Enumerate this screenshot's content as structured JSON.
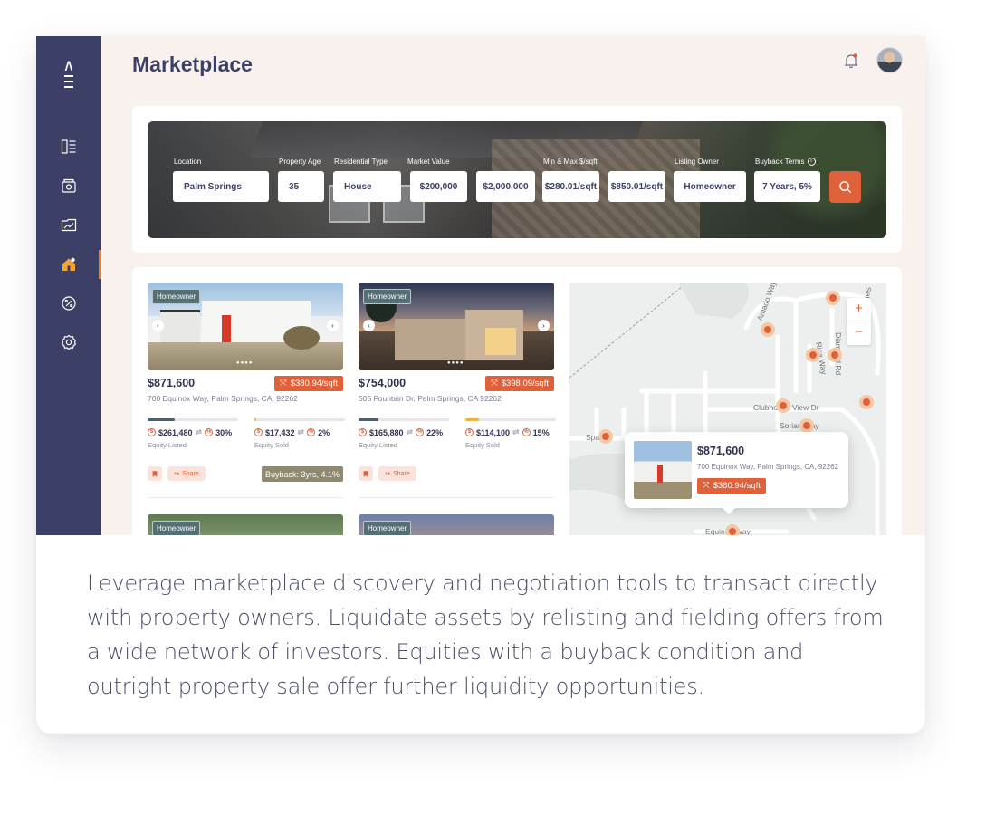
{
  "app": {
    "title": "Marketplace"
  },
  "sidebar": {
    "items": [
      {
        "icon": "dashboard-icon"
      },
      {
        "icon": "vault-icon"
      },
      {
        "icon": "portfolio-chart-icon"
      },
      {
        "icon": "home-icon",
        "active": true
      },
      {
        "icon": "percent-badge-icon"
      },
      {
        "icon": "gear-icon"
      }
    ]
  },
  "header": {
    "notification_icon": "bell-icon",
    "avatar": "user-avatar"
  },
  "filters": {
    "location": {
      "label": "Location",
      "value": "Palm Springs"
    },
    "property_age": {
      "label": "Property Age",
      "value": "35"
    },
    "residential_type": {
      "label": "Residential Type",
      "value": "House"
    },
    "market_value": {
      "label": "Market Value",
      "min": "$200,000",
      "max": "$2,000,000"
    },
    "price_per_sqft": {
      "label": "Min & Max $/sqft",
      "min": "$280.01/sqft",
      "max": "$850.01/sqft"
    },
    "listing_owner": {
      "label": "Listing Owner",
      "value": "Homeowner"
    },
    "buyback_terms": {
      "label": "Buyback Terms",
      "value": "7 Years, 5%"
    },
    "search_button_icon": "search-icon"
  },
  "listings": [
    {
      "badge": "Homeowner",
      "price": "$871,600",
      "price_per_sqft": "$380.94/sqft",
      "address": "700 Equinox Way, Palm Springs, CA, 92262",
      "equity_listed": {
        "amount": "$261,480",
        "percent": "30%",
        "label": "Equity Listed",
        "fill": 0.3
      },
      "equity_sold": {
        "amount": "$17,432",
        "percent": "2%",
        "label": "Equity Sold",
        "fill": 0.02
      },
      "share_label": "Share",
      "buyback": "Buyback: 3yrs, 4.1%"
    },
    {
      "badge": "Homeowner",
      "price": "$754,000",
      "price_per_sqft": "$398.09/sqft",
      "address": "505 Fountain Dr, Palm Springs, CA 92262",
      "equity_listed": {
        "amount": "$165,880",
        "percent": "22%",
        "label": "Equity Listed",
        "fill": 0.22
      },
      "equity_sold": {
        "amount": "$114,100",
        "percent": "15%",
        "label": "Equity Sold",
        "fill": 0.15
      },
      "share_label": "Share"
    },
    {
      "badge": "Homeowner"
    },
    {
      "badge": "Homeowner"
    }
  ],
  "map": {
    "labels": [
      "Amado Way",
      "San Marco Dr",
      "Rica Way",
      "Diamond Rd",
      "Clubhouse View Dr",
      "Sorian Way",
      "Spa Rd",
      "Equinox Way"
    ],
    "zoom_in": "+",
    "zoom_out": "−",
    "popup": {
      "price": "$871,600",
      "address": "700 Equinox Way, Palm Springs, CA, 92262",
      "price_per_sqft": "$380.94/sqft"
    }
  },
  "caption": "Leverage marketplace discovery and negotiation tools to transact directly with property owners. Liquidate assets by relisting and fielding offers from a wide network of investors. Equities with a buyback condition and outright property sale offer further liquidity opportunities.",
  "colors": {
    "sidebar": "#3c4066",
    "accent": "#e0603a",
    "active_indicator": "#e87f2a",
    "badge": "#557074",
    "buyback": "#8f8a6e"
  }
}
